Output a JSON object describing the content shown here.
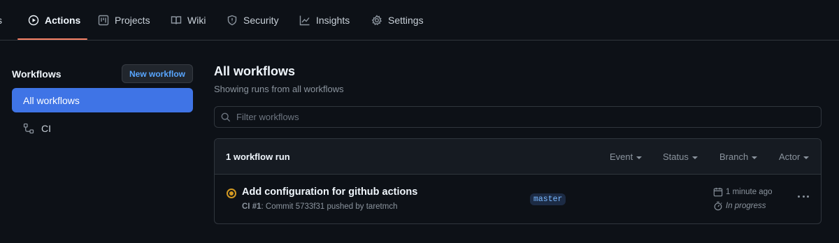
{
  "nav": {
    "tabs": [
      {
        "label": "s",
        "icon": "pull-request-icon"
      },
      {
        "label": "Actions",
        "icon": "play-icon",
        "selected": true
      },
      {
        "label": "Projects",
        "icon": "project-icon"
      },
      {
        "label": "Wiki",
        "icon": "book-icon"
      },
      {
        "label": "Security",
        "icon": "shield-icon"
      },
      {
        "label": "Insights",
        "icon": "graph-icon"
      },
      {
        "label": "Settings",
        "icon": "gear-icon"
      }
    ],
    "accent_color": "#f78166"
  },
  "sidebar": {
    "title": "Workflows",
    "new_button": "New workflow",
    "items": [
      {
        "label": "All workflows",
        "active": true
      },
      {
        "label": "CI",
        "icon": "workflow-icon"
      }
    ],
    "active_color": "#3f74e6"
  },
  "main": {
    "title": "All workflows",
    "subtitle": "Showing runs from all workflows",
    "filter_placeholder": "Filter workflows",
    "runs": {
      "count_label": "1 workflow run",
      "filters": [
        "Event",
        "Status",
        "Branch",
        "Actor"
      ],
      "items": [
        {
          "title": "Add configuration for github actions",
          "workflow_ref": "CI #1",
          "description": ": Commit 5733f31 pushed by taretmch",
          "branch": "master",
          "time": "1 minute ago",
          "duration": "In progress",
          "status": "in-progress",
          "status_color": "#d29922"
        }
      ]
    }
  }
}
